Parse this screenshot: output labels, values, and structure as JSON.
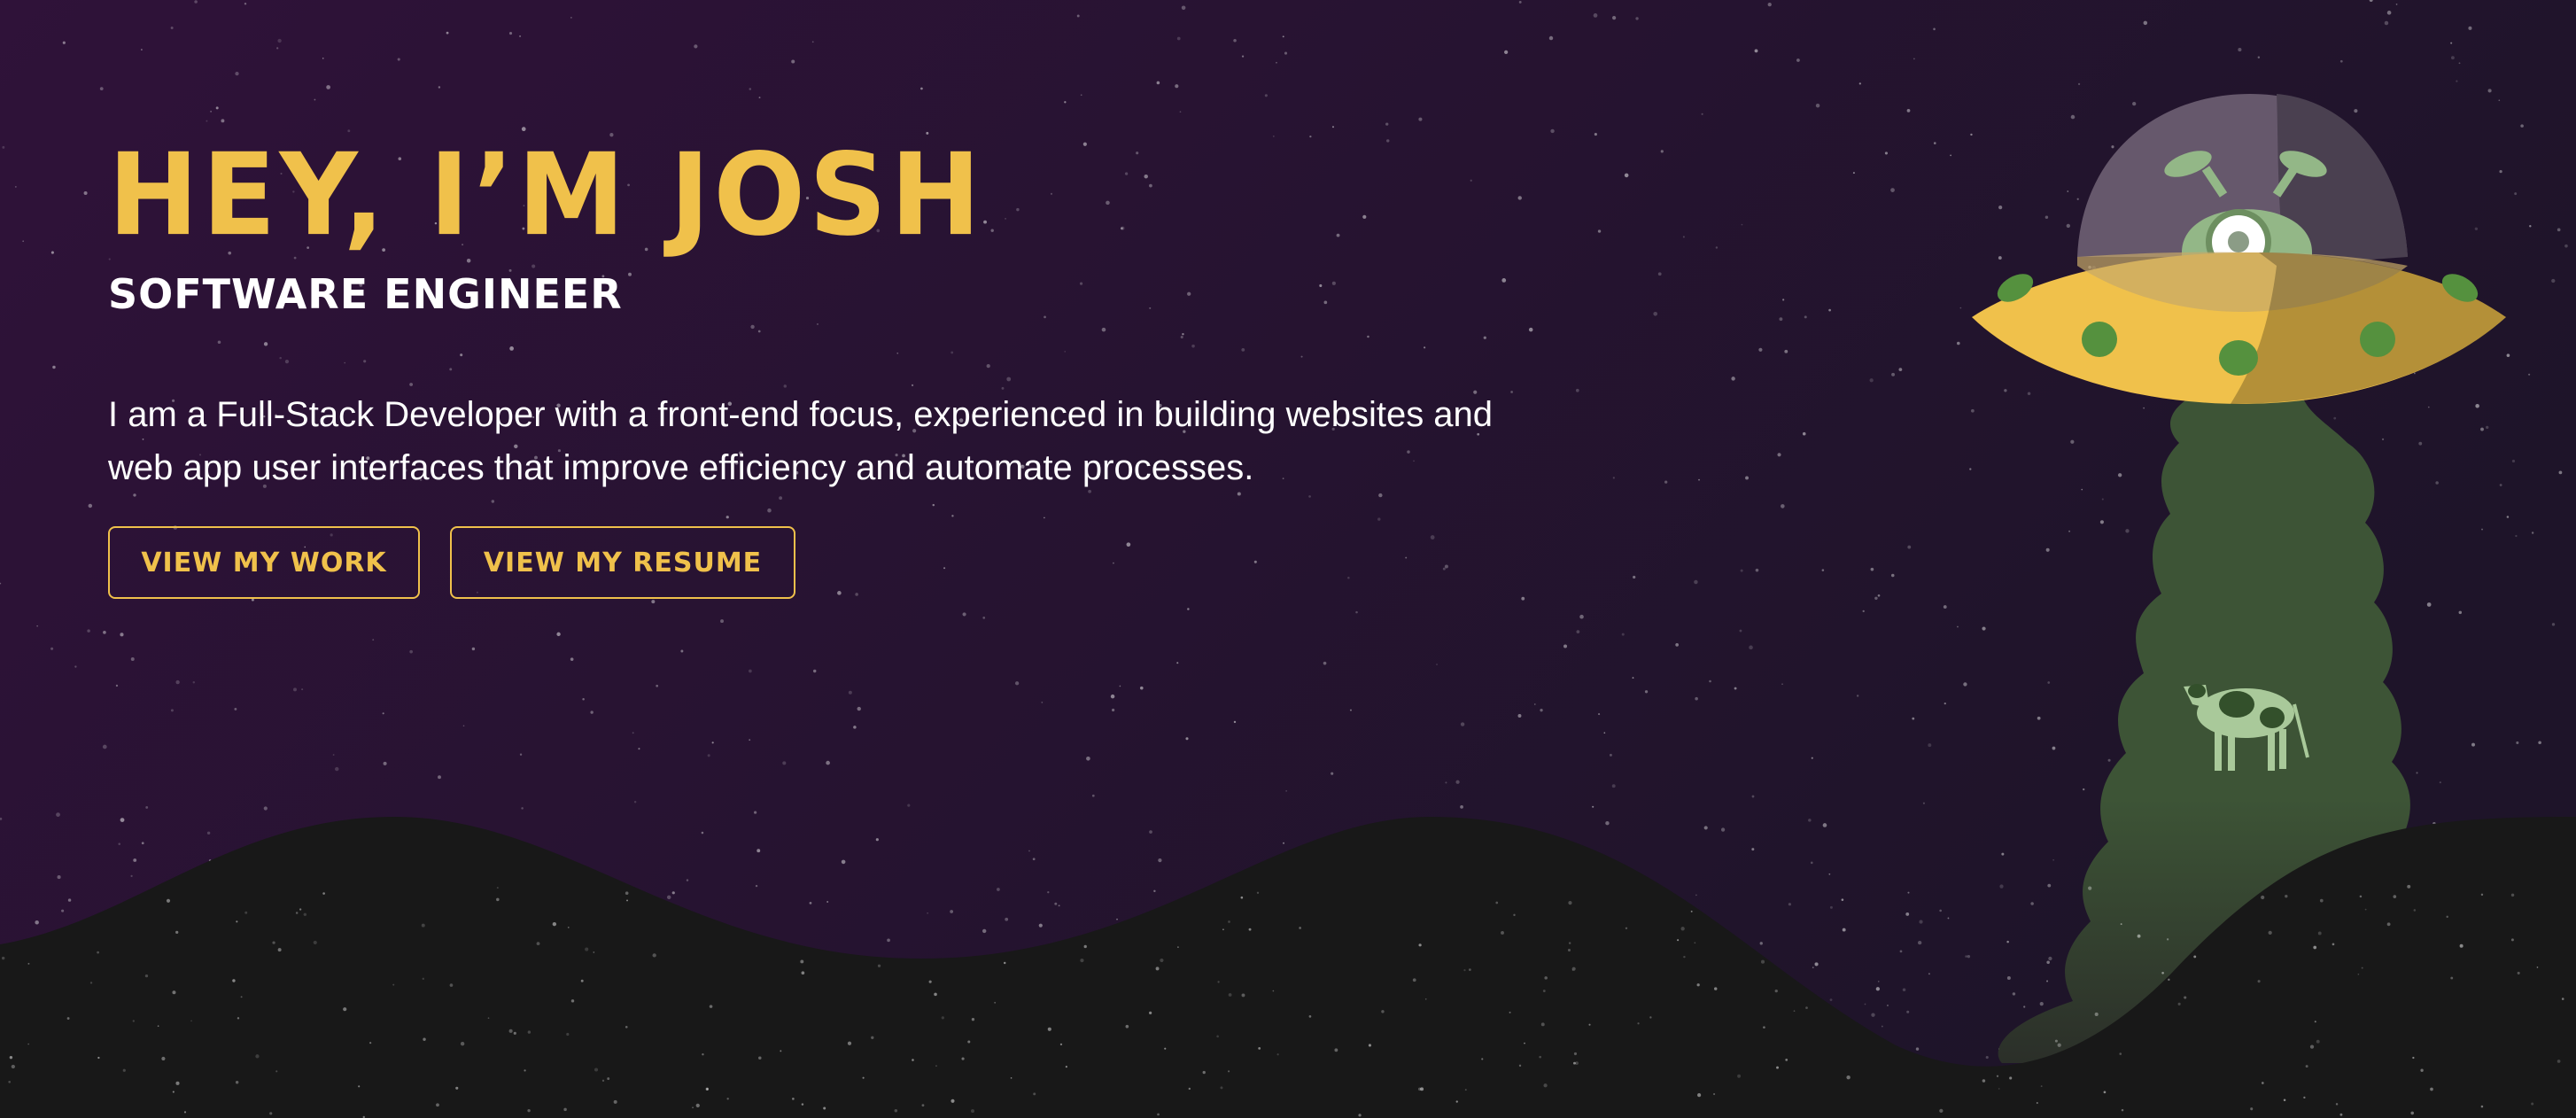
{
  "hero": {
    "title": "HEY, I’M JOSH",
    "subtitle": "SOFTWARE ENGINEER",
    "description": "I am a Full-Stack Developer with a front-end focus, experienced in building websites and web app user interfaces that improve efficiency and automate processes.",
    "buttons": [
      {
        "label": "VIEW MY WORK"
      },
      {
        "label": "VIEW MY RESUME"
      }
    ]
  },
  "colors": {
    "accent": "#f0c14b",
    "background": "#221429",
    "ground": "#181818",
    "beam": "#3d5436",
    "alien": "#93b787"
  },
  "illustration": {
    "icons": [
      "ufo-icon",
      "alien-icon",
      "cow-icon",
      "tractor-beam",
      "hills",
      "stars"
    ]
  }
}
